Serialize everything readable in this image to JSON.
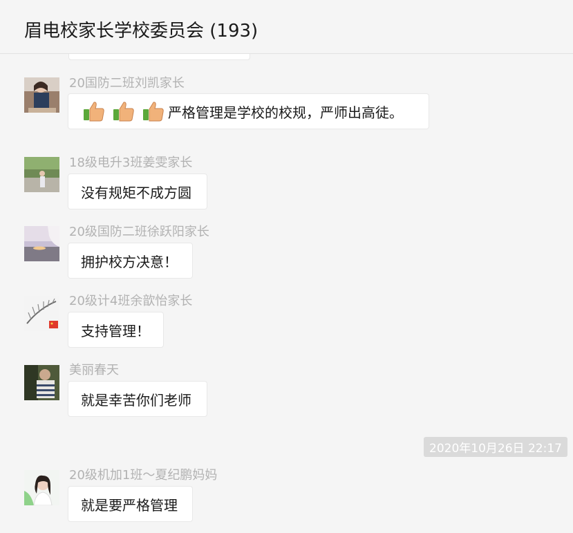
{
  "header": {
    "title": "眉电校家长学校委员会 (193)"
  },
  "messages": [
    {
      "sender": "20国防二班刘凯家长",
      "text": "严格管理是学校的校规，严师出高徒。",
      "emoji": [
        "thumbs-up",
        "thumbs-up",
        "thumbs-up"
      ]
    },
    {
      "sender": "18级电升3班姜雯家长",
      "text": "没有规矩不成方圆"
    },
    {
      "sender": "20级国防二班徐跃阳家长",
      "text": "拥护校方决意！"
    },
    {
      "sender": "20级计4班余歆怡家长",
      "text": "支持管理！"
    },
    {
      "sender": "美丽春天",
      "text": "就是幸苦你们老师"
    },
    {
      "sender": "20级机加1班～夏纪鹏妈妈",
      "text": "就是要严格管理"
    }
  ],
  "timestamp": "2020年10月26日 22:17",
  "colors": {
    "background": "#f5f5f5",
    "bubble": "#ffffff",
    "sender_name": "#b2b2b2",
    "timestamp_bg": "#dadada"
  }
}
